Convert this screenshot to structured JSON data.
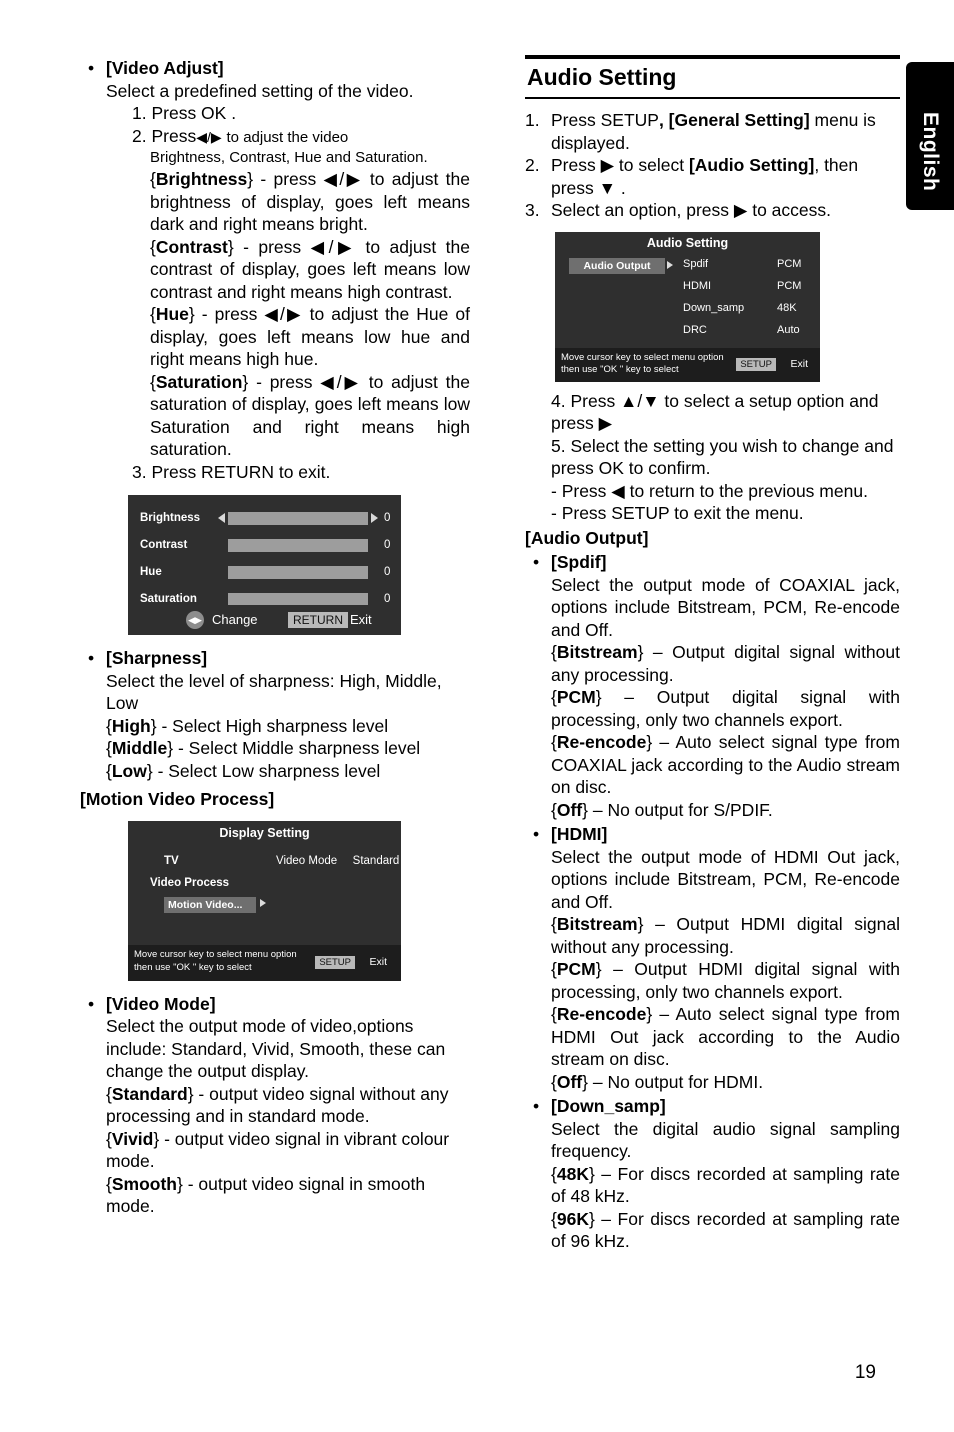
{
  "language_tab": "English",
  "page_number": "19",
  "left_column": {
    "video_adjust": {
      "bullet": "•",
      "title": "[Video Adjust]",
      "intro": "Select a predefined setting of the video.",
      "step1": "1. Press OK .",
      "step2_pre": "2. Press",
      "step2_arrows": "◀/▶",
      "step2_post": "to adjust the video",
      "step2_line2": "Brightness, Contrast, Hue and Saturation.",
      "brightness": "{Brightness} - press ◀/▶ to adjust the brightness of display, goes left means dark and right means bright.",
      "brightness_label": "Brightness",
      "contrast_label": "Contrast",
      "contrast": "{Contrast} - press ◀/▶ to adjust the contrast of display, goes left means low contrast and right means high contrast.",
      "hue_label": "Hue",
      "hue": "{Hue} - press ◀/▶ to adjust the Hue of display, goes left means low hue and right means high hue.",
      "saturation_label": "Saturation",
      "saturation": "{Saturation} - press ◀/▶ to adjust the saturation of display, goes left means low Saturation and right means high saturation.",
      "step3": "3. Press RETURN to exit."
    },
    "video_adjust_osd": {
      "rows": [
        {
          "label": "Brightness",
          "value": "0"
        },
        {
          "label": "Contrast",
          "value": "0"
        },
        {
          "label": "Hue",
          "value": "0"
        },
        {
          "label": "Saturation",
          "value": "0"
        }
      ],
      "dpad_icon": "◀▶",
      "change_label": "Change",
      "return_key": "RETURN",
      "exit_label": "Exit"
    },
    "sharpness": {
      "bullet": "•",
      "title": "[Sharpness]",
      "intro": "Select the level of sharpness: High, Middle, Low",
      "high": "{High} - Select High sharpness level",
      "high_label": "High",
      "middle_label": "Middle",
      "middle": "{Middle} - Select Middle sharpness level",
      "low_label": "Low",
      "low": "{Low} - Select Low sharpness level"
    },
    "motion_video_process_heading": "[Motion Video Process]",
    "display_setting_osd": {
      "title": "Display Setting",
      "item_tv": "TV",
      "item_video_process": "Video Process",
      "item_selected": "Motion Video...",
      "option_label": "Video Mode",
      "option_value": "Standard",
      "footer_line1": "Move cursor key to select menu option",
      "footer_line2": "then use \"OK \" key to select",
      "setup_key": "SETUP",
      "exit_label": "Exit"
    },
    "video_mode": {
      "bullet": "•",
      "title": "[Video Mode]",
      "intro": "Select the output mode of video,options include: Standard, Vivid, Smooth, these can change the output display.",
      "standard_label": "Standard",
      "standard": "{Standard} - output video signal without any processing and in standard mode.",
      "vivid_label": "Vivid",
      "vivid": "{Vivid} - output video signal in vibrant colour mode.",
      "smooth_label": "Smooth",
      "smooth": "{Smooth} - output video signal in smooth mode."
    }
  },
  "right_column": {
    "section_title": "Audio Setting",
    "steps": [
      {
        "n": "1.",
        "text": "Press SETUP, [General Setting] menu is displayed."
      },
      {
        "n": "2.",
        "text": "Press ▶ to select [Audio Setting], then press ▼ ."
      },
      {
        "n": "3.",
        "text": "Select an option, press ▶ to access."
      }
    ],
    "step1_a": "Press SETUP",
    "step1_b": ", [General Setting] ",
    "step1_c": "menu is displayed.",
    "step2_a": "Press ▶ to select ",
    "step2_b": "[Audio Setting]",
    "step2_c": ", then press ▼ .",
    "step3_text": "Select an option, press ▶ to access.",
    "audio_setting_osd": {
      "title": "Audio Setting",
      "selected_item": "Audio Output",
      "rows": [
        {
          "label": "Spdif",
          "value": "PCM"
        },
        {
          "label": "HDMI",
          "value": "PCM"
        },
        {
          "label": "Down_samp",
          "value": "48K"
        },
        {
          "label": "DRC",
          "value": "Auto"
        }
      ],
      "footer_line1": "Move cursor key to select menu option",
      "footer_line2": "then use \"OK \" key to select",
      "setup_key": "SETUP",
      "exit_label": "Exit"
    },
    "step4": "4. Press ▲/▼ to select a setup option and press ▶",
    "step5": "5. Select the setting you wish to change and press OK to confirm.",
    "step5_sub1": "- Press ◀ to return to the previous menu.",
    "step5_sub2": "- Press SETUP to exit the menu.",
    "audio_output_heading": "[Audio Output]",
    "spdif": {
      "bullet": "•",
      "title": "[Spdif]",
      "intro": "Select the output mode of COAXIAL jack, options include Bitstream, PCM, Re-encode and Off.",
      "bitstream_label": "Bitstream",
      "bitstream": "{Bitstream} – Output digital signal without any processing.",
      "pcm_label": "PCM",
      "pcm": "{PCM} – Output digital signal with processing, only two channels export.",
      "reencode_label": "Re-encode",
      "reencode": "{Re-encode} – Auto select signal type from COAXIAL jack according to the Audio stream on disc.",
      "off_label": "Off",
      "off": "{Off} – No output for S/PDIF."
    },
    "hdmi": {
      "bullet": "•",
      "title": "[HDMI]",
      "intro": "Select the output mode of HDMI Out jack, options include Bitstream, PCM, Re-encode and Off.",
      "bitstream_label": "Bitstream",
      "bitstream": "{Bitstream} – Output HDMI digital signal without any processing.",
      "pcm_label": "PCM",
      "pcm": "{PCM} – Output HDMI digital signal with processing, only two channels export.",
      "reencode_label": "Re-encode",
      "reencode": "{Re-encode} – Auto select signal type from HDMI Out jack according to the Audio stream on disc.",
      "off_label": "Off",
      "off": "{Off} – No output for HDMI."
    },
    "down_samp": {
      "bullet": "•",
      "title": "[Down_samp]",
      "intro": "Select the digital audio signal sampling frequency.",
      "k48_label": "48K",
      "k48": "{48K} – For discs recorded at sampling rate of 48 kHz.",
      "k96_label": "96K",
      "k96": "{96K} – For discs recorded at sampling rate of 96 kHz."
    }
  }
}
